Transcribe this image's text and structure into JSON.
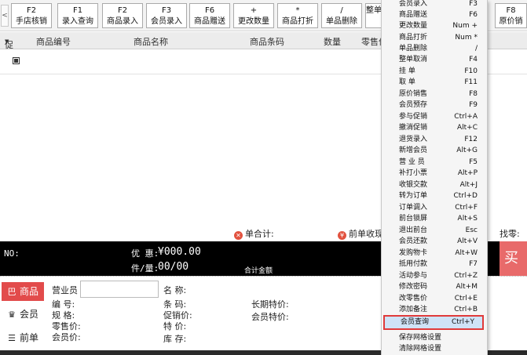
{
  "toolbar": {
    "scroll_arrow": "<",
    "buttons": [
      {
        "key": "F2",
        "label": "手店核销"
      },
      {
        "key": "F1",
        "label": "录入查询"
      },
      {
        "key": "F2",
        "label": "商品录入"
      },
      {
        "key": "F3",
        "label": "会员录入"
      },
      {
        "key": "F6",
        "label": "商品赠送"
      },
      {
        "key": "+",
        "label": "更改数量"
      },
      {
        "key": "*",
        "label": "商品打折"
      },
      {
        "key": "/",
        "label": "单品删除"
      },
      {
        "key": "",
        "label": "整单"
      },
      {
        "key": "F8",
        "label": "原价销"
      }
    ]
  },
  "table": {
    "columns": [
      "促",
      "商品编号",
      "商品名称",
      "商品条码",
      "数量",
      "零售价"
    ]
  },
  "summary": {
    "total_label": "单合计:",
    "prev_label": "前单收现",
    "change_label": "找零:"
  },
  "statusbar": {
    "no_label": "NO:",
    "discount_label": "优 惠:",
    "discount_value": "¥000.00",
    "pieces_label": "件/量:",
    "pieces_value": "00/00",
    "total_amount_label": "合计金额",
    "pay_label": "买"
  },
  "sidenav": [
    {
      "icon": "巴",
      "label": "商品"
    },
    {
      "icon": "♛",
      "label": "会员"
    },
    {
      "icon": "☰",
      "label": "前单"
    }
  ],
  "details": {
    "salesperson": "营业员",
    "code": "编   号:",
    "spec": "规   格:",
    "retail": "零售价:",
    "member_price": "会员价:",
    "name": "名   称:",
    "barcode": "条   码:",
    "promo_price": "促销价:",
    "special": "特   价:",
    "stock": "库   存:",
    "long_special": "长期特价:",
    "member_special": "会员特价:"
  },
  "menu": {
    "items": [
      {
        "label": "会员录入",
        "shortcut": "F3"
      },
      {
        "label": "商品赠送",
        "shortcut": "F6"
      },
      {
        "label": "更改数量",
        "shortcut": "Num +"
      },
      {
        "label": "商品打折",
        "shortcut": "Num *"
      },
      {
        "label": "单品删除",
        "shortcut": "/"
      },
      {
        "label": "整单取消",
        "shortcut": "F4"
      },
      {
        "label": "挂   单",
        "shortcut": "F10"
      },
      {
        "label": "取   单",
        "shortcut": "F11"
      },
      {
        "label": "原价销售",
        "shortcut": "F8"
      },
      {
        "label": "会员预存",
        "shortcut": "F9"
      },
      {
        "label": "参与促销",
        "shortcut": "Ctrl+A"
      },
      {
        "label": "撤消促销",
        "shortcut": "Alt+C"
      },
      {
        "label": "退货录入",
        "shortcut": "F12"
      },
      {
        "label": "新增会员",
        "shortcut": "Alt+G"
      },
      {
        "label": "营 业 员",
        "shortcut": "F5"
      },
      {
        "label": "补打小票",
        "shortcut": "Alt+P"
      },
      {
        "label": "收银交款",
        "shortcut": "Alt+J"
      },
      {
        "label": "转为订单",
        "shortcut": "Ctrl+D"
      },
      {
        "label": "订单调入",
        "shortcut": "Ctrl+F"
      },
      {
        "label": "前台锁屏",
        "shortcut": "Alt+S"
      },
      {
        "label": "退出前台",
        "shortcut": "Esc"
      },
      {
        "label": "会员还款",
        "shortcut": "Alt+V"
      },
      {
        "label": "发购物卡",
        "shortcut": "Alt+W"
      },
      {
        "label": "抵用付款",
        "shortcut": "F7"
      },
      {
        "label": "活动参与",
        "shortcut": "Ctrl+Z"
      },
      {
        "label": "修改密码",
        "shortcut": "Alt+M"
      },
      {
        "label": "改零售价",
        "shortcut": "Ctrl+E"
      },
      {
        "label": "添加备注",
        "shortcut": "Ctrl+B"
      },
      {
        "label": "会员查询",
        "shortcut": "Ctrl+Y"
      },
      {
        "label": "保存网格设置",
        "shortcut": ""
      },
      {
        "label": "清除网格设置",
        "shortcut": ""
      }
    ]
  },
  "colors": {
    "accent_red": "#e24b4b",
    "highlight_border": "#e03a3a",
    "highlight_fill": "#cfe3f7"
  }
}
